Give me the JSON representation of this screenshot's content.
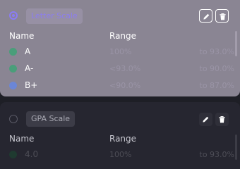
{
  "cards": [
    {
      "scale_name": "Letter Scale",
      "headers": {
        "name": "Name",
        "range": "Range"
      },
      "selected": true,
      "rows": [
        {
          "grade": "A",
          "range_start": "100%",
          "range_end": "to 93.0%",
          "dot_color": "#4a9e7a"
        },
        {
          "grade": "A-",
          "range_start": "<93.0%",
          "range_end": "to 90.0%",
          "dot_color": "#4a9e7a"
        },
        {
          "grade": "B+",
          "range_start": "<90.0%",
          "range_end": "to 87.0%",
          "dot_color": "#6b86d6"
        }
      ]
    },
    {
      "scale_name": "GPA Scale",
      "headers": {
        "name": "Name",
        "range": "Range"
      },
      "selected": false,
      "rows": [
        {
          "grade": "4.0",
          "range_start": "100%",
          "range_end": "to 93.0%",
          "dot_color": "#1f3a30"
        }
      ]
    }
  ],
  "icons": {
    "edit": "pencil-icon",
    "delete": "trash-icon"
  },
  "colors": {
    "accent": "#8a7cf4",
    "selected_card_bg": "#8a8593",
    "card_bg": "#262630",
    "page_bg": "#1e1f26"
  }
}
